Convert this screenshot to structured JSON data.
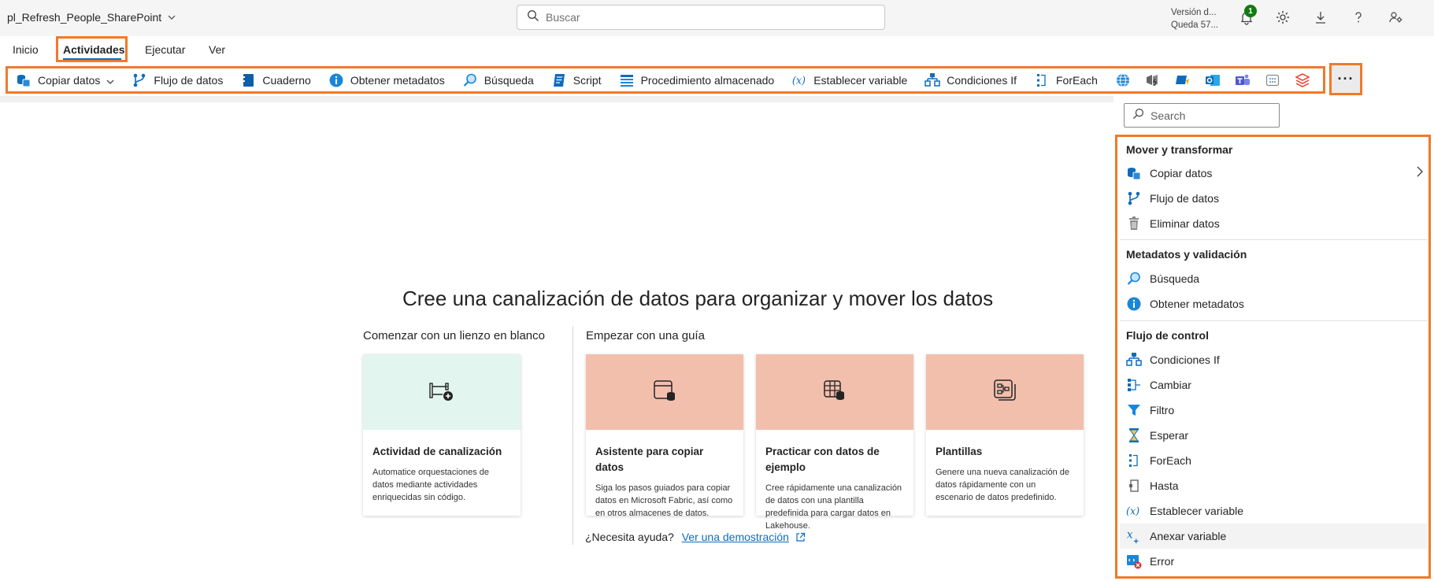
{
  "window": {
    "title": "pl_Refresh_People_SharePoint"
  },
  "search": {
    "placeholder": "Buscar"
  },
  "version": {
    "line1": "Versión d...",
    "line2": "Queda 57..."
  },
  "notifications": {
    "count": "1"
  },
  "tabs": [
    {
      "label": "Inicio"
    },
    {
      "label": "Actividades"
    },
    {
      "label": "Ejecutar"
    },
    {
      "label": "Ver"
    }
  ],
  "toolbar": {
    "items": [
      {
        "label": "Copiar datos",
        "icon": "copy-data-icon"
      },
      {
        "label": "Flujo de datos",
        "icon": "dataflow-icon"
      },
      {
        "label": "Cuaderno",
        "icon": "notebook-icon"
      },
      {
        "label": "Obtener metadatos",
        "icon": "info-icon"
      },
      {
        "label": "Búsqueda",
        "icon": "lookup-icon"
      },
      {
        "label": "Script",
        "icon": "script-icon"
      },
      {
        "label": "Procedimiento almacenado",
        "icon": "stored-procedure-icon"
      },
      {
        "label": "Establecer variable",
        "icon": "variable-icon"
      },
      {
        "label": "Condiciones If",
        "icon": "if-condition-icon"
      },
      {
        "label": "ForEach",
        "icon": "foreach-icon"
      }
    ],
    "more_label": "···"
  },
  "main": {
    "headline": "Cree una canalización de datos para organizar y mover los datos",
    "blank_section": "Comenzar con un lienzo en blanco",
    "guide_section": "Empezar con una guía",
    "cards": [
      {
        "title": "Actividad de canalización",
        "desc": "Automatice orquestaciones de datos mediante actividades enriquecidas sin código."
      },
      {
        "title": "Asistente para copiar datos",
        "desc": "Siga los pasos guiados para copiar datos en Microsoft Fabric, así como en otros almacenes de datos."
      },
      {
        "title": "Practicar con datos de ejemplo",
        "desc": "Cree rápidamente una canalización de datos con una plantilla predefinida para cargar datos en Lakehouse."
      },
      {
        "title": "Plantillas",
        "desc": "Genere una nueva canalización de datos rápidamente con un escenario de datos predefinido."
      }
    ],
    "help_text": "¿Necesita ayuda?",
    "help_link": "Ver una demostración"
  },
  "pane": {
    "search_placeholder": "Search",
    "groups": [
      {
        "label": "Mover y transformar",
        "items": [
          "Copiar datos",
          "Flujo de datos",
          "Eliminar datos"
        ]
      },
      {
        "label": "Metadatos y validación",
        "items": [
          "Búsqueda",
          "Obtener metadatos"
        ]
      },
      {
        "label": "Flujo de control",
        "items": [
          "Condiciones If",
          "Cambiar",
          "Filtro",
          "Esperar",
          "ForEach",
          "Hasta",
          "Establecer variable",
          "Anexar variable",
          "Error"
        ]
      }
    ]
  },
  "colors": {
    "accent": "#0f6cbd",
    "highlight": "#f07a2a",
    "card_green": "#e2f5ee",
    "card_salmon": "#f2bfad"
  }
}
